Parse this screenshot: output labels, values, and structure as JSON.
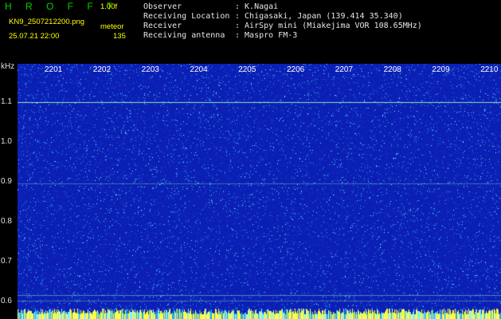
{
  "header": {
    "logo": "H R O F F T",
    "version": "1.00f",
    "filename": "KN9_2507212200.png",
    "meteor_label": "meteor",
    "datetime": "25.07.21 22:00",
    "count": "135",
    "info": [
      {
        "label": "Observer",
        "value": ": K.Nagai"
      },
      {
        "label": "Receiving Location",
        "value": ": Chigasaki, Japan (139.414 35.340)"
      },
      {
        "label": "Receiver",
        "value": ": AirSpy mini (Miakejima VOR 108.65MHz)"
      },
      {
        "label": "Receiving antenna",
        "value": ": Maspro FM-3"
      }
    ]
  },
  "chart_data": {
    "type": "heatmap",
    "ylabel": "kHz",
    "y_ticks": [
      "1.1",
      "1.0",
      "0.9",
      "0.8",
      "0.7",
      "0.6"
    ],
    "x_ticks": [
      "2201",
      "2202",
      "2203",
      "2204",
      "2205",
      "2206",
      "2207",
      "2208",
      "2209",
      "2210"
    ],
    "colors": {
      "background": "#0c1fb4",
      "noise_low": "#1640e0",
      "noise_mid": "#23a8e6",
      "noise_high": "#7cf0ff",
      "signal": "#ffff40",
      "carrier": "#9affb0"
    }
  }
}
